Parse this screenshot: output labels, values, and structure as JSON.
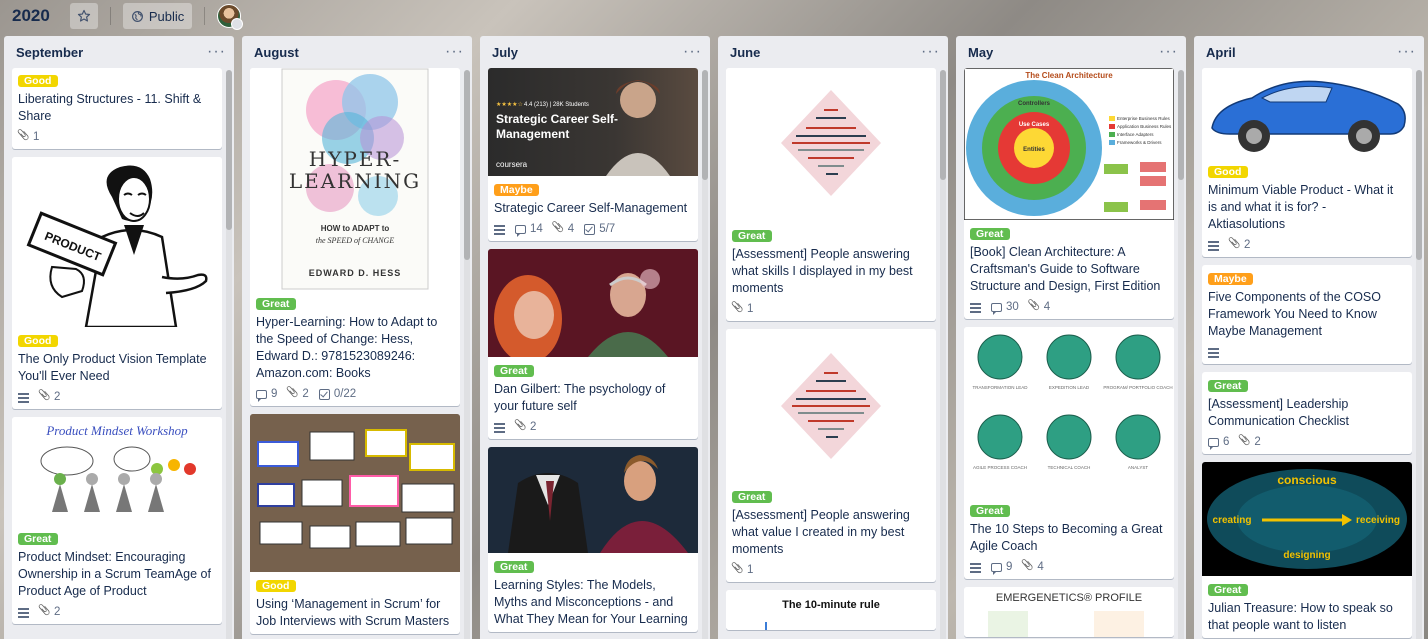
{
  "board": {
    "title": "2020",
    "visibility": "Public",
    "star_icon": "star-icon",
    "globe_icon": "globe-icon"
  },
  "lists": [
    {
      "title": "September",
      "cards": [
        {
          "label": "Good",
          "label_color": "#f2d600",
          "title": "Liberating Structures - 11. Shift & Share",
          "attachments": "1"
        },
        {
          "label": "Good",
          "label_color": "#f2d600",
          "title": "The Only Product Vision Template You'll Ever Need",
          "attachments": "2"
        },
        {
          "label": "Great",
          "label_color": "#61bd4f",
          "title": "Product Mindset: Encouraging Ownership in a Scrum TeamAge of Product Age of Product",
          "attachments": "2",
          "cover_text": "Product Mindset Workshop"
        }
      ]
    },
    {
      "title": "August",
      "cards": [
        {
          "label": "Great",
          "label_color": "#61bd4f",
          "title": "Hyper-Learning: How to Adapt to the Speed of Change: Hess, Edward D.: 9781523089246: Amazon.com: Books",
          "comments": "9",
          "attachments": "2",
          "checklist": "0/22",
          "cover": {
            "title": "HYPER-LEARNING",
            "subtitle": "HOW to ADAPT to the SPEED of CHANGE",
            "author": "EDWARD D. HESS"
          }
        },
        {
          "label": "Good",
          "label_color": "#f2d600",
          "title": "Using ‘Management in Scrum’ for Job Interviews with Scrum Masters"
        }
      ]
    },
    {
      "title": "July",
      "cards": [
        {
          "label": "Maybe",
          "label_color": "#ff9f1a",
          "title": "Strategic Career Self-Management",
          "comments": "14",
          "attachments": "4",
          "checklist": "5/7",
          "cover": {
            "rating": "4.4 (213) | 28K Students",
            "title": "Strategic Career Self-Management",
            "brand": "coursera"
          }
        },
        {
          "label": "Great",
          "label_color": "#61bd4f",
          "title": "Dan Gilbert: The psychology of your future self",
          "attachments": "2"
        },
        {
          "label": "Great",
          "label_color": "#61bd4f",
          "title": "Learning Styles: The Models, Myths and Misconceptions - and What They Mean for Your Learning"
        }
      ]
    },
    {
      "title": "June",
      "cards": [
        {
          "label": "Great",
          "label_color": "#61bd4f",
          "title": "[Assessment] People answering what skills I displayed in my best moments",
          "attachments": "1"
        },
        {
          "label": "Great",
          "label_color": "#61bd4f",
          "title": "[Assessment] People answering what value I created in my best moments",
          "attachments": "1"
        },
        {
          "cover_text": "The 10-minute rule"
        }
      ]
    },
    {
      "title": "May",
      "cards": [
        {
          "label": "Great",
          "label_color": "#61bd4f",
          "title": "[Book] Clean Architecture: A Craftsman's Guide to Software Structure and Design, First Edition",
          "comments": "30",
          "attachments": "4",
          "cover": {
            "title": "The Clean Architecture",
            "rings": [
              "Entities",
              "Use Cases",
              "Controllers",
              "External Interfaces"
            ],
            "legend": [
              "Enterprise Business Rules",
              "Application Business Rules",
              "Interface Adapters",
              "Frameworks & Drivers"
            ]
          }
        },
        {
          "label": "Great",
          "label_color": "#61bd4f",
          "title": "The 10 Steps to Becoming a Great Agile Coach",
          "comments": "9",
          "attachments": "4",
          "cover": {
            "roles": [
              "TRANSFORMATION LEAD",
              "EXPEDITION LEAD",
              "PROGRAM/ PORTFOLIO COACH",
              "AGILE PROCESS COACH",
              "TECHNICAL COACH",
              "ANALYST"
            ]
          }
        },
        {
          "cover_text": "EMERGENETICS® PROFILE"
        }
      ]
    },
    {
      "title": "April",
      "cards": [
        {
          "label": "Good",
          "label_color": "#f2d600",
          "title": "Minimum Viable Product - What it is and what it is for? - Aktiasolutions",
          "attachments": "2"
        },
        {
          "label": "Maybe",
          "label_color": "#ff9f1a",
          "title": "Five Components of the COSO Framework You Need to Know Maybe Management"
        },
        {
          "label": "Great",
          "label_color": "#61bd4f",
          "title": "[Assessment] Leadership Communication Checklist",
          "comments": "6",
          "attachments": "2"
        },
        {
          "label": "Great",
          "label_color": "#61bd4f",
          "title": "Julian Treasure: How to speak so that people want to listen",
          "cover": {
            "top": "conscious",
            "left": "creating",
            "right": "receiving",
            "bottom": "designing"
          }
        }
      ]
    }
  ]
}
